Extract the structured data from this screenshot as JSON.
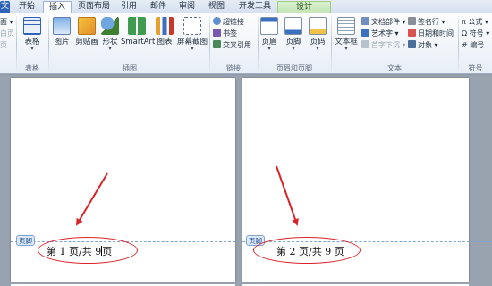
{
  "tabs": [
    {
      "label": "文件"
    },
    {
      "label": "开始"
    },
    {
      "label": "插入"
    },
    {
      "label": "页面布局"
    },
    {
      "label": "引用"
    },
    {
      "label": "邮件"
    },
    {
      "label": "审阅"
    },
    {
      "label": "视图"
    },
    {
      "label": "开发工具"
    },
    {
      "label": "设计"
    }
  ],
  "ribbon": {
    "left_edge": {
      "item1": "面 ▾",
      "item2": "白页",
      "item3": "页"
    },
    "tables": {
      "table": "表格",
      "group": "表格"
    },
    "illustrations": {
      "picture": "图片",
      "clipart": "剪贴画",
      "shapes": "形状",
      "smartart": "SmartArt",
      "chart": "图表",
      "screenshot": "屏幕截图",
      "group": "插图"
    },
    "links": {
      "hyperlink": "超链接",
      "bookmark": "书签",
      "crossref": "交叉引用",
      "group": "链接"
    },
    "header_footer": {
      "header": "页眉",
      "footer": "页脚",
      "pagenum": "页码",
      "group": "页眉和页脚"
    },
    "text": {
      "textbox": "文本框",
      "quickparts": "文档部件 ▾",
      "wordart": "艺术字 ▾",
      "dropcap": "首字下沉 ▾",
      "signature": "签名行 ▾",
      "datetime": "日期和时间",
      "object": "对象 ▾",
      "group": "文本"
    },
    "symbols": {
      "equation": "π 公式 ▾",
      "symbol": "Ω 符号 ▾",
      "number": "# 编号",
      "group": "符号"
    }
  },
  "document": {
    "footer_tag": "页脚",
    "page1_footer": {
      "before_cursor": "第 1 页/共 9",
      "after_cursor": "页"
    },
    "page2_footer": "第 2 页/共 9 页"
  },
  "colors": {
    "annotation": "#d9252a",
    "file_tab": "#2f63b8",
    "context_tab": "#c3e5b4"
  }
}
